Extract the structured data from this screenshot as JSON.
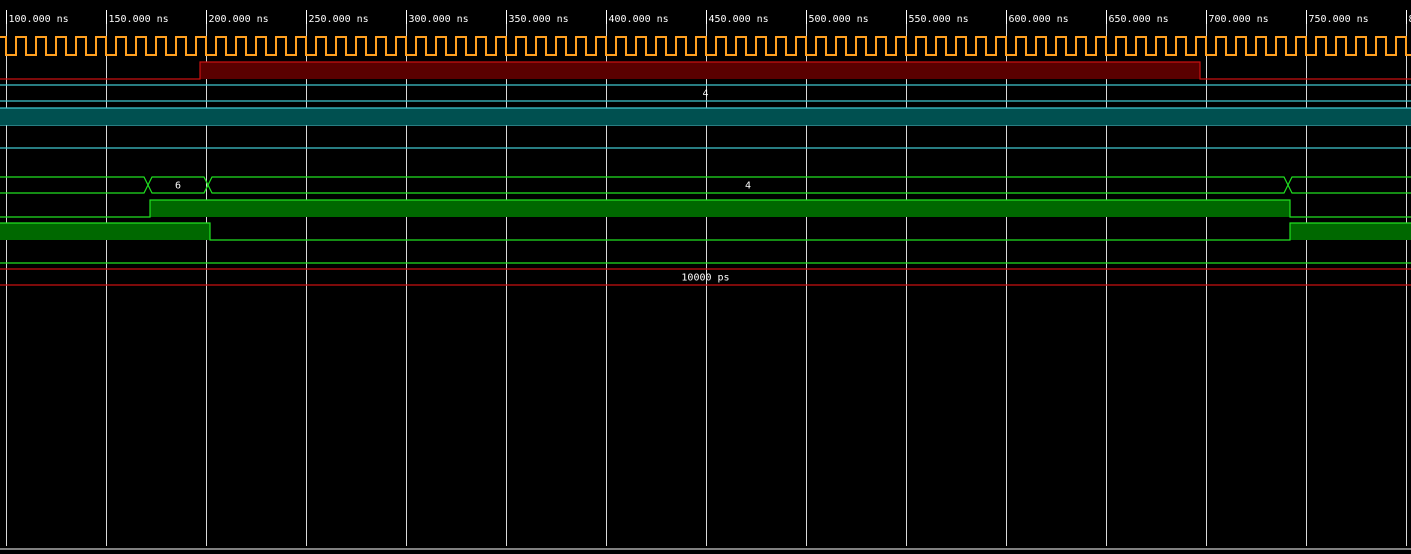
{
  "timeline": {
    "unit": "ns",
    "ticks": [
      {
        "t": 100,
        "label": "100.000 ns"
      },
      {
        "t": 150,
        "label": "150.000 ns"
      },
      {
        "t": 200,
        "label": "200.000 ns"
      },
      {
        "t": 250,
        "label": "250.000 ns"
      },
      {
        "t": 300,
        "label": "300.000 ns"
      },
      {
        "t": 350,
        "label": "350.000 ns"
      },
      {
        "t": 400,
        "label": "400.000 ns"
      },
      {
        "t": 450,
        "label": "450.000 ns"
      },
      {
        "t": 500,
        "label": "500.000 ns"
      },
      {
        "t": 550,
        "label": "550.000 ns"
      },
      {
        "t": 600,
        "label": "600.000 ns"
      },
      {
        "t": 650,
        "label": "650.000 ns"
      },
      {
        "t": 700,
        "label": "700.000 ns"
      },
      {
        "t": 750,
        "label": "750.000 ns"
      },
      {
        "t": 800,
        "label": "8"
      }
    ],
    "view_start_ns": 97,
    "view_end_ns": 802.5,
    "clock_period_ns": 10
  },
  "colors": {
    "grid": "#ffffff",
    "clock": "#ffa020",
    "red": "#c81010",
    "red_fill": "#5a0000",
    "cyan": "#40c8d0",
    "cyan_fill": "#005050",
    "green": "#20e020",
    "green_fill": "#006800",
    "text": "#ffffff"
  },
  "signals": [
    {
      "id": "clk",
      "kind": "clock",
      "color": "clock"
    },
    {
      "id": "red-bit",
      "kind": "bit",
      "color": "red",
      "segments": [
        {
          "from": 97,
          "to": 197,
          "level": 0
        },
        {
          "from": 197,
          "to": 697,
          "level": 1
        },
        {
          "from": 697,
          "to": 802.5,
          "level": 0
        }
      ]
    },
    {
      "id": "cyan-bus-1",
      "kind": "bus",
      "color": "cyan",
      "segments": [
        {
          "from": 97,
          "to": 802.5,
          "label": "4"
        }
      ]
    },
    {
      "id": "cyan-bit-1",
      "kind": "bit",
      "color": "cyan",
      "segments": [
        {
          "from": 97,
          "to": 802.5,
          "level": 0
        }
      ]
    },
    {
      "id": "cyan-bit-2",
      "kind": "bit",
      "color": "cyan",
      "segments": [
        {
          "from": 97,
          "to": 802.5,
          "level": 1
        }
      ]
    },
    {
      "id": "cyan-bit-3",
      "kind": "bit",
      "color": "cyan",
      "segments": [
        {
          "from": 97,
          "to": 802.5,
          "level": 0
        }
      ]
    },
    {
      "id": "green-bus",
      "kind": "bus",
      "color": "green",
      "segments": [
        {
          "from": 97,
          "to": 171,
          "label": ""
        },
        {
          "from": 171,
          "to": 201,
          "label": "6"
        },
        {
          "from": 201,
          "to": 741,
          "label": "4"
        },
        {
          "from": 741,
          "to": 802.5,
          "label": ""
        }
      ]
    },
    {
      "id": "green-bit-1",
      "kind": "bit",
      "color": "green",
      "segments": [
        {
          "from": 97,
          "to": 172,
          "level": 0
        },
        {
          "from": 172,
          "to": 742,
          "level": 1
        },
        {
          "from": 742,
          "to": 802.5,
          "level": 0
        }
      ]
    },
    {
      "id": "green-bit-2",
      "kind": "bit",
      "color": "green",
      "segments": [
        {
          "from": 97,
          "to": 202,
          "level": 1
        },
        {
          "from": 202,
          "to": 742,
          "level": 0
        },
        {
          "from": 742,
          "to": 802.5,
          "level": 1
        }
      ]
    },
    {
      "id": "green-bit-3",
      "kind": "bit",
      "color": "green",
      "segments": [
        {
          "from": 97,
          "to": 802.5,
          "level": 0
        }
      ]
    },
    {
      "id": "red-bus",
      "kind": "bus",
      "color": "red",
      "segments": [
        {
          "from": 97,
          "to": 802.5,
          "label": "10000 ps"
        }
      ]
    }
  ]
}
